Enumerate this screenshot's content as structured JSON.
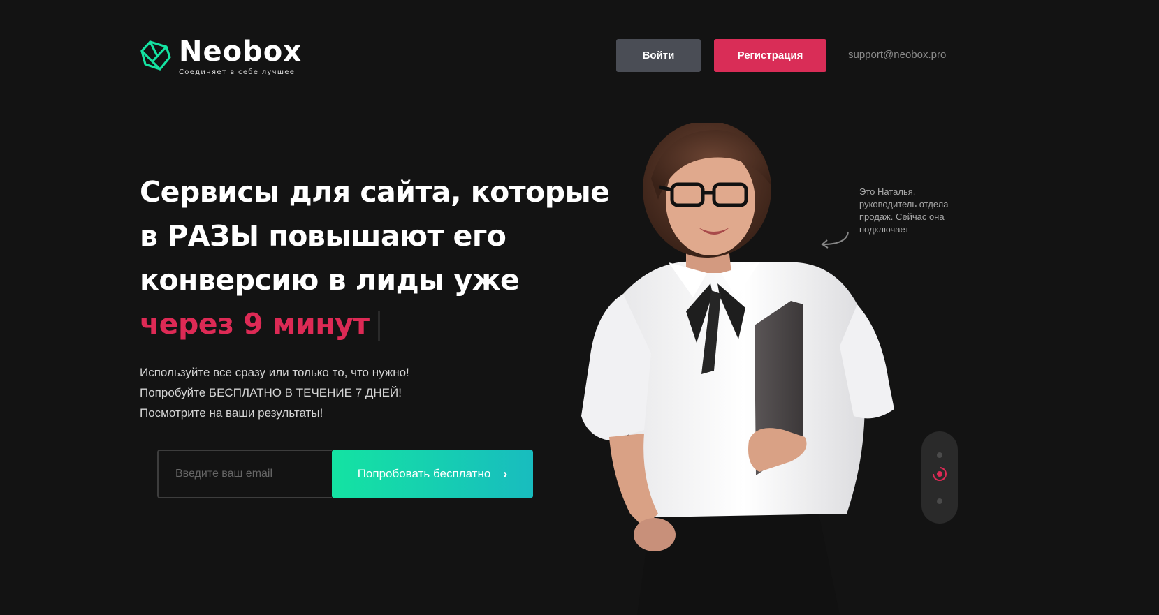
{
  "brand": {
    "name": "Neobox",
    "tagline": "Соединяет в себе лучшее",
    "accent_color": "#14e3a2"
  },
  "header": {
    "login_label": "Войти",
    "register_label": "Регистрация",
    "support_email": "support@neobox.pro"
  },
  "hero": {
    "headline_lines": [
      "Сервисы для сайта, которые",
      "в РАЗЫ повышают его",
      "конверсию в лиды уже"
    ],
    "headline_accent": "через 9 минут",
    "accent_color": "#dd2a55",
    "sub_lines": [
      "Используйте все сразу или только то, что нужно!",
      "Попробуйте БЕСПЛАТНО В ТЕЧЕНИЕ 7 ДНЕЙ!",
      "Посмотрите на ваши результаты!"
    ]
  },
  "form": {
    "email_placeholder": "Введите ваш email",
    "email_value": "",
    "cta_label": "Попробовать бесплатно",
    "cta_icon": "chevron-right-icon"
  },
  "annotation": {
    "text": "Это Наталья, руководитель отдела продаж. Сейчас она подключает"
  },
  "slider": {
    "dots": 3,
    "active_index": 1,
    "active_color": "#dd2a55"
  }
}
